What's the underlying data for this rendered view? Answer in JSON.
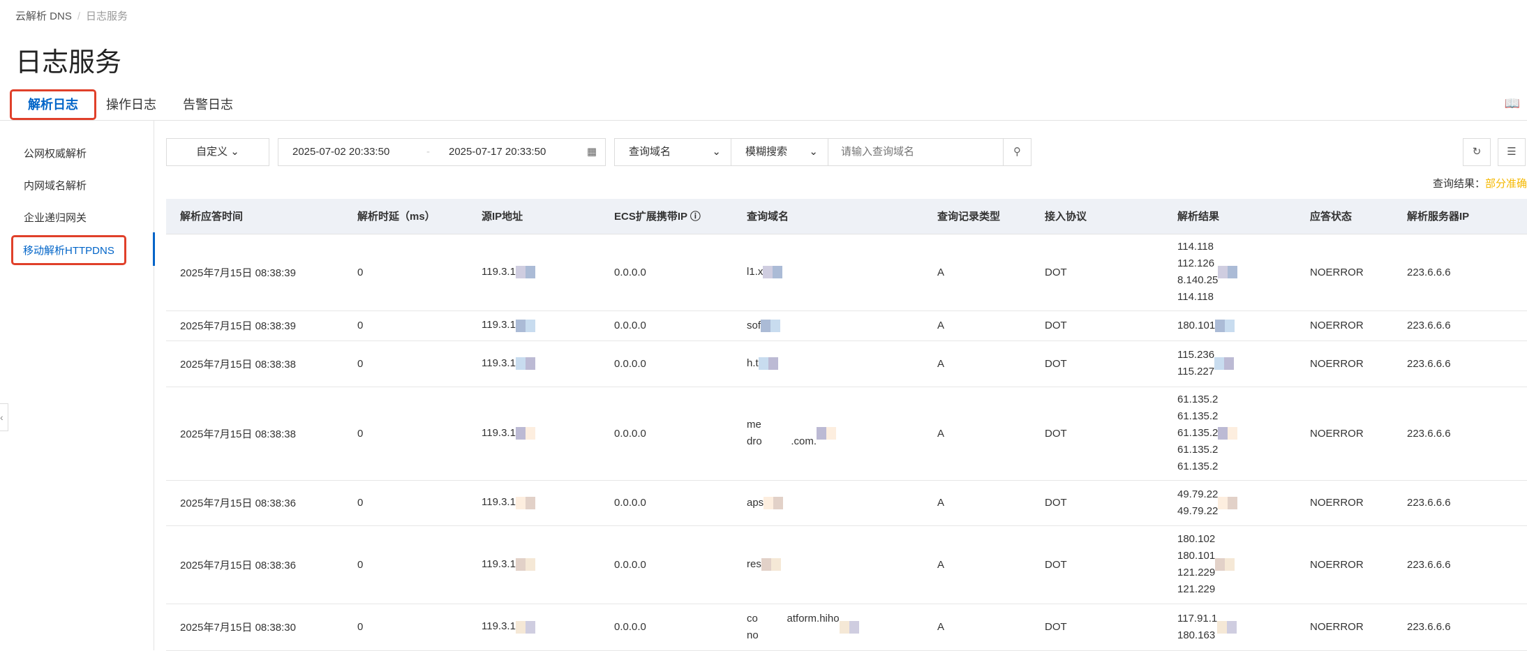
{
  "breadcrumb": [
    "云解析 DNS",
    "日志服务"
  ],
  "page_title": "日志服务",
  "tabs": [
    "解析日志",
    "操作日志",
    "告警日志"
  ],
  "sidebar": [
    "公网权威解析",
    "内网域名解析",
    "企业递归网关",
    "移动解析HTTPDNS"
  ],
  "toolbar": {
    "range": "自定义",
    "start": "2025-07-02 20:33:50",
    "sep": "-",
    "end": "2025-07-17 20:33:50",
    "field": "查询域名",
    "mode": "模糊搜索",
    "placeholder": "请输入查询域名"
  },
  "result_label": "查询结果：",
  "result_value": "部分准确",
  "columns": [
    "解析应答时间",
    "解析时延（ms）",
    "源IP地址",
    "ECS扩展携带IP ⓘ",
    "查询域名",
    "查询记录类型",
    "接入协议",
    "解析结果",
    "应答状态",
    "解析服务器IP"
  ],
  "rows": [
    {
      "time": "2025年7月15日 08:38:39",
      "latency": "0",
      "src": "119.3.1",
      "ecs": "0.0.0.0",
      "domain": [
        "l1.x"
      ],
      "type": "A",
      "proto": "DOT",
      "results": [
        "114.118",
        "112.126",
        "8.140.25",
        "114.118"
      ],
      "status": "NOERROR",
      "server": "223.6.6.6"
    },
    {
      "time": "2025年7月15日 08:38:39",
      "latency": "0",
      "src": "119.3.1",
      "ecs": "0.0.0.0",
      "domain": [
        "sof"
      ],
      "type": "A",
      "proto": "DOT",
      "results": [
        "180.101"
      ],
      "status": "NOERROR",
      "server": "223.6.6.6"
    },
    {
      "time": "2025年7月15日 08:38:38",
      "latency": "0",
      "src": "119.3.1",
      "ecs": "0.0.0.0",
      "domain": [
        "h.t"
      ],
      "type": "A",
      "proto": "DOT",
      "results": [
        "115.236",
        "115.227"
      ],
      "status": "NOERROR",
      "server": "223.6.6.6"
    },
    {
      "time": "2025年7月15日 08:38:38",
      "latency": "0",
      "src": "119.3.1",
      "ecs": "0.0.0.0",
      "domain": [
        "me",
        "dro          .com."
      ],
      "type": "A",
      "proto": "DOT",
      "results": [
        "61.135.2",
        "61.135.2",
        "61.135.2",
        "61.135.2",
        "61.135.2"
      ],
      "status": "NOERROR",
      "server": "223.6.6.6"
    },
    {
      "time": "2025年7月15日 08:38:36",
      "latency": "0",
      "src": "119.3.1",
      "ecs": "0.0.0.0",
      "domain": [
        "aps"
      ],
      "type": "A",
      "proto": "DOT",
      "results": [
        "49.79.22",
        "49.79.22"
      ],
      "status": "NOERROR",
      "server": "223.6.6.6"
    },
    {
      "time": "2025年7月15日 08:38:36",
      "latency": "0",
      "src": "119.3.1",
      "ecs": "0.0.0.0",
      "domain": [
        "res"
      ],
      "type": "A",
      "proto": "DOT",
      "results": [
        "180.102",
        "180.101",
        "121.229",
        "121.229"
      ],
      "status": "NOERROR",
      "server": "223.6.6.6"
    },
    {
      "time": "2025年7月15日 08:38:30",
      "latency": "0",
      "src": "119.3.1",
      "ecs": "0.0.0.0",
      "domain": [
        "co          atform.hiho",
        "no"
      ],
      "type": "A",
      "proto": "DOT",
      "results": [
        "117.91.1",
        "180.163"
      ],
      "status": "NOERROR",
      "server": "223.6.6.6"
    }
  ]
}
